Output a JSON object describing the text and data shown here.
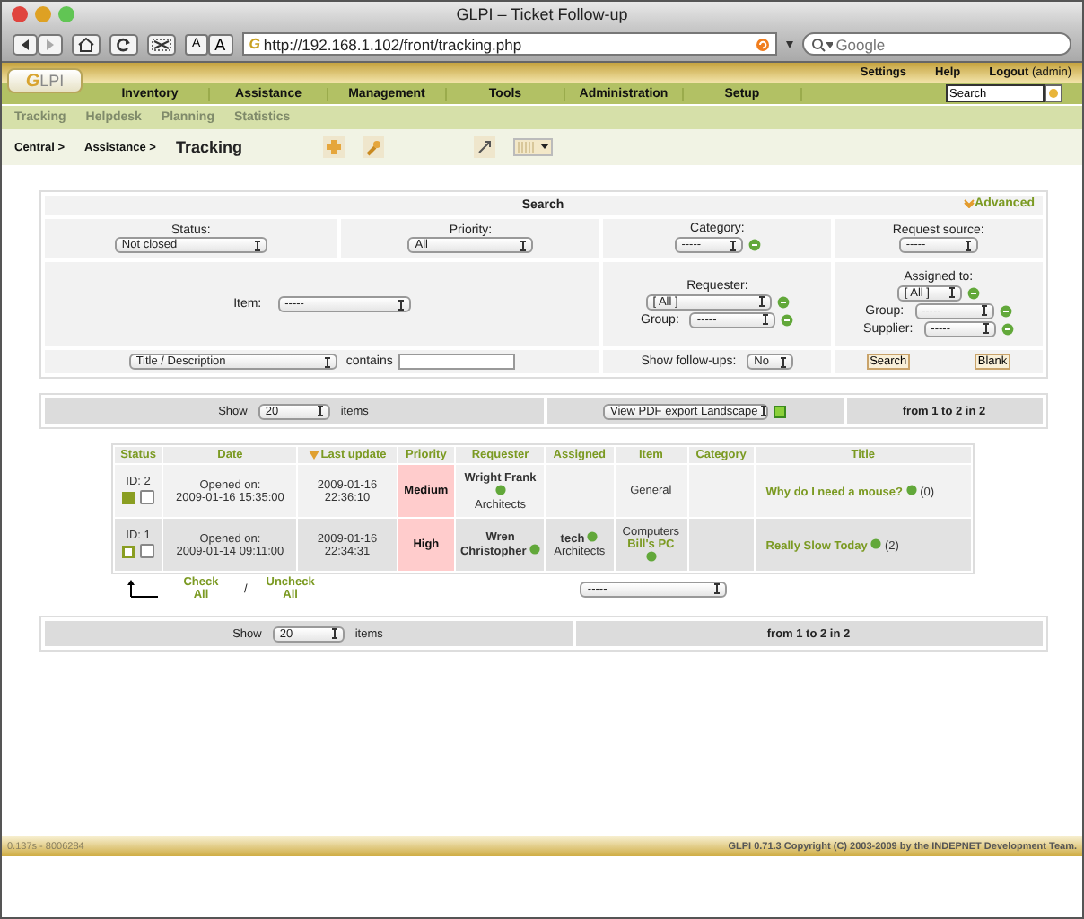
{
  "window": {
    "title": "GLPI – Ticket Follow-up"
  },
  "browser": {
    "favicon": "G",
    "text_size_buttons": [
      "A",
      "A"
    ],
    "url": "http://192.168.1.102/front/tracking.php",
    "search_placeholder": "Google"
  },
  "header": {
    "logo": "GLPI",
    "links": [
      "Settings",
      "Help"
    ],
    "logout": "Logout",
    "user": "(admin)",
    "menu": [
      "Inventory",
      "Assistance",
      "Management",
      "Tools",
      "Administration",
      "Setup"
    ],
    "search_value": "Search",
    "submenu": [
      "Tracking",
      "Helpdesk",
      "Planning",
      "Statistics"
    ],
    "breadcrumb": [
      "Central >",
      "Assistance >"
    ],
    "page_title": "Tracking"
  },
  "search": {
    "title": "Search",
    "advanced": "Advanced",
    "status_label": "Status:",
    "status_value": "Not closed",
    "priority_label": "Priority:",
    "priority_value": "All",
    "category_label": "Category:",
    "category_value": "-----",
    "source_label": "Request source:",
    "source_value": "-----",
    "item_label": "Item:",
    "item_value": "-----",
    "requester_label": "Requester:",
    "requester_value": "[ All ]",
    "group_label": "Group:",
    "group_value": "-----",
    "assigned_label": "Assigned to:",
    "assigned_value": "[ All ]",
    "assigned_group_label": "Group:",
    "assigned_group_value": "-----",
    "supplier_label": "Supplier:",
    "supplier_value": "-----",
    "field_value": "Title / Description",
    "contains_label": "contains",
    "followups_label": "Show follow-ups:",
    "followups_value": "No",
    "search_button": "Search",
    "blank_button": "Blank"
  },
  "pager_top": {
    "show_label": "Show",
    "count": "20",
    "items_label": "items",
    "export_value": "View PDF export Landscape",
    "range": "from 1 to 2 in 2"
  },
  "table": {
    "columns": [
      "Status",
      "Date",
      "Last update",
      "Priority",
      "Requester",
      "Assigned",
      "Item",
      "Category",
      "Title"
    ],
    "rows": [
      {
        "id": "ID: 2",
        "status_filled": true,
        "checked": false,
        "date": [
          "Opened on:",
          "2009-01-16 15:35:00"
        ],
        "last_update": [
          "2009-01-16",
          "22:36:10"
        ],
        "priority": "Medium",
        "requester": "Wright Frank",
        "requester_group": "Architects",
        "item_type": "General",
        "title": "Why do I need a mouse?",
        "followups": "(0)"
      },
      {
        "id": "ID: 1",
        "status_filled": false,
        "checked": false,
        "date": [
          "Opened on:",
          "2009-01-14 09:11:00"
        ],
        "last_update": [
          "2009-01-16",
          "22:34:31"
        ],
        "priority": "High",
        "requester": "Wren Christopher",
        "assigned": "tech",
        "assigned_group": "Architects",
        "item_type": "Computers",
        "item_name": "Bill's PC",
        "title": "Really Slow Today",
        "followups": "(2)"
      }
    ]
  },
  "bulk": {
    "check_all": "Check All",
    "separator": "/",
    "uncheck_all": "Uncheck All",
    "action_value": "-----"
  },
  "pager_bottom": {
    "show_label": "Show",
    "count": "20",
    "items_label": "items",
    "range": "from 1 to 2 in 2"
  },
  "footer": {
    "timing": "0.137s - 8006284",
    "copyright": "GLPI 0.71.3 Copyright (C) 2003-2009 by the INDEPNET Development Team."
  }
}
